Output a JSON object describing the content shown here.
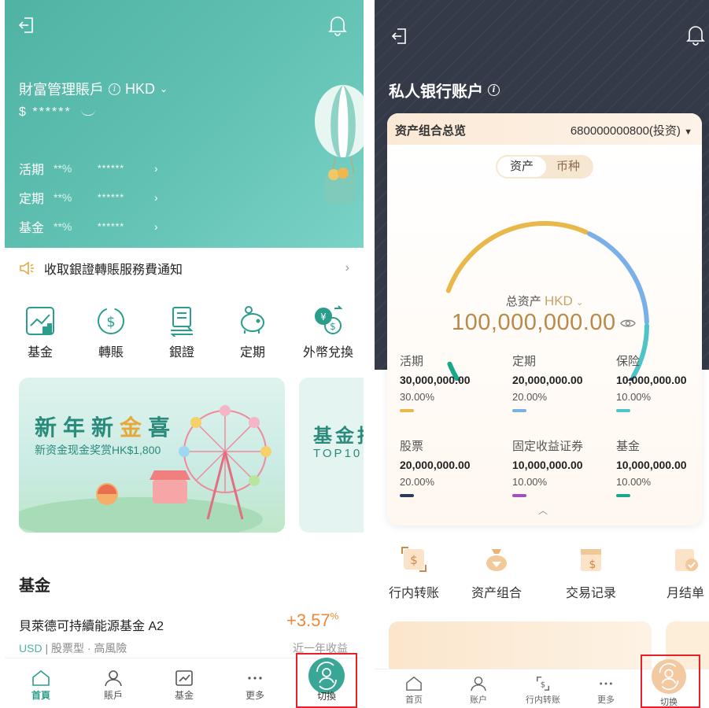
{
  "left": {
    "header": {
      "account_title": "財富管理賬戶",
      "currency": "HKD",
      "balance": "$ ******",
      "rates": [
        {
          "name": "活期",
          "pct": "**%",
          "amount": "******"
        },
        {
          "name": "定期",
          "pct": "**%",
          "amount": "******"
        },
        {
          "name": "基金",
          "pct": "**%",
          "amount": "******"
        }
      ]
    },
    "notice": "收取銀證轉賬服務費通知",
    "quick_actions": [
      "基金",
      "轉賬",
      "銀證",
      "定期",
      "外幣兌換"
    ],
    "banner1": {
      "title_a": "新年新",
      "title_gold": "金",
      "title_b": "喜",
      "subtitle": "新资金现金奖赏HK$1,800"
    },
    "banner2": {
      "title": "基金拍",
      "subtitle": "TOP10"
    },
    "fund_section": {
      "title": "基金",
      "fund_name": "貝萊德可持續能源基金 A2",
      "currency": "USD",
      "meta": "| 股票型 · 高風險",
      "return_value": "+3.57",
      "return_unit": "%",
      "return_label": "近一年收益"
    },
    "nav": [
      "首頁",
      "賬戶",
      "基金",
      "更多"
    ],
    "switch_label": "切換",
    "colors": {
      "brand": "#4fb3a4",
      "accent": "#f0883a",
      "highlight": "#e8202a"
    }
  },
  "right": {
    "title": "私人银行账户",
    "card": {
      "title": "资产组合总览",
      "account": "680000000800(投资)",
      "toggle": [
        "资产",
        "币种"
      ],
      "total_label": "总资产",
      "total_currency": "HKD",
      "total_value": "100,000,000.00",
      "assets": [
        {
          "name": "活期",
          "value": "30,000,000.00",
          "pct": "30.00%",
          "color": "#e8b84a"
        },
        {
          "name": "定期",
          "value": "20,000,000.00",
          "pct": "20.00%",
          "color": "#7ab0e8"
        },
        {
          "name": "保险",
          "value": "10,000,000.00",
          "pct": "10.00%",
          "color": "#4fc4c8"
        },
        {
          "name": "股票",
          "value": "20,000,000.00",
          "pct": "20.00%",
          "color": "#2a3a5c"
        },
        {
          "name": "固定收益证券",
          "value": "10,000,000.00",
          "pct": "10.00%",
          "color": "#a050c0"
        },
        {
          "name": "基金",
          "value": "10,000,000.00",
          "pct": "10.00%",
          "color": "#1aa88a"
        }
      ]
    },
    "quick_actions": [
      "行内转账",
      "资产组合",
      "交易记录",
      "月结单"
    ],
    "nav": [
      "首页",
      "账户",
      "行内转账",
      "更多"
    ],
    "switch_label": "切换",
    "colors": {
      "dark": "#343a48",
      "gold": "#b78a4a"
    }
  }
}
